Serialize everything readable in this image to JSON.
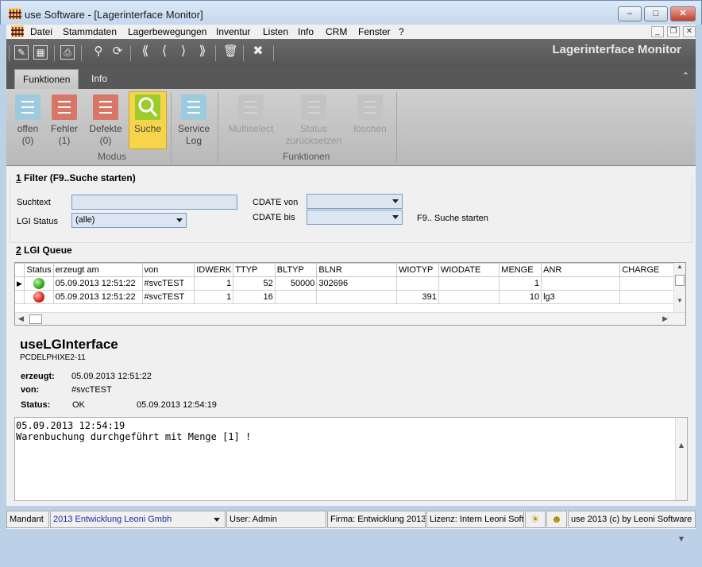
{
  "window": {
    "title": "use Software - [Lagerinterface Monitor]"
  },
  "menu": [
    "Datei",
    "Stammdaten",
    "Lagerbewegungen",
    "Inventur",
    "Listen",
    "Info",
    "CRM",
    "Fenster",
    "?"
  ],
  "toolbar": {
    "monitor_title": "Lagerinterface Monitor"
  },
  "tabs": [
    "Funktionen",
    "Info"
  ],
  "ribbon": {
    "modus": [
      {
        "label1": "offen",
        "label2": "(0)",
        "color": "#9ccbe0"
      },
      {
        "label1": "Fehler",
        "label2": "(1)",
        "color": "#d87767"
      },
      {
        "label1": "Defekte",
        "label2": "(0)",
        "color": "#d87767"
      },
      {
        "label1": "Suche",
        "label2": "",
        "color": "#9ccc2c"
      }
    ],
    "service": {
      "label1": "Service",
      "label2": "Log",
      "color": "#9ccbe0"
    },
    "funktionen": [
      {
        "label1": "Multiselect",
        "label2": ""
      },
      {
        "label1": "Status",
        "label2": "zurücksetzen"
      },
      {
        "label1": "löschen",
        "label2": ""
      }
    ],
    "group_modus": "Modus",
    "group_funktionen": "Funktionen"
  },
  "filter": {
    "title_num": "1",
    "title": " Filter (F9..Suche starten)",
    "suchtext_label": "Suchtext",
    "suchtext_value": "",
    "lgi_status_label": "LGI Status",
    "lgi_status_value": "(alle)",
    "cdate_von_label": "CDATE von",
    "cdate_bis_label": "CDATE bis",
    "hint": "F9.. Suche starten"
  },
  "queue": {
    "title_num": "2",
    "title": " LGI Queue",
    "columns": [
      "Status",
      "erzeugt am",
      "von",
      "IDWERK",
      "TTYP",
      "BLTYP",
      "BLNR",
      "WIOTYP",
      "WIODATE",
      "MENGE",
      "ANR",
      "CHARGE"
    ],
    "rows": [
      {
        "status": "green",
        "erzeugt": "05.09.2013 12:51:22",
        "von": "#svcTEST",
        "idwerk": "1",
        "ttyp": "52",
        "bltyp": "50000",
        "blnr": "302696",
        "wiotyp": "",
        "wiodate": "",
        "menge": "1",
        "anr": "",
        "charge": ""
      },
      {
        "status": "red",
        "erzeugt": "05.09.2013 12:51:22",
        "von": "#svcTEST",
        "idwerk": "1",
        "ttyp": "16",
        "bltyp": "",
        "blnr": "",
        "wiotyp": "391",
        "wiodate": "",
        "menge": "10",
        "anr": "lg3",
        "charge": ""
      }
    ]
  },
  "detail": {
    "app": "useLGInterface",
    "host": "PCDELPHIXE2-11",
    "erzeugt_label": "erzeugt:",
    "erzeugt_value": "05.09.2013 12:51:22",
    "von_label": "von:",
    "von_value": "#svcTEST",
    "status_label": "Status:",
    "status_value": "OK",
    "status_time": "05.09.2013 12:54:19"
  },
  "log": {
    "line1": "05.09.2013 12:54:19",
    "line2": "Warenbuchung durchgeführt mit Menge [1] !"
  },
  "statusbar": {
    "mandant_label": "Mandant",
    "mandant_value": "2013 Entwicklung Leoni Gmbh",
    "user": "User: Admin",
    "firma": "Firma: Entwicklung 2013",
    "lizenz": "Lizenz: Intern Leoni Software",
    "copyright": "use 2013 (c) by Leoni Software"
  }
}
